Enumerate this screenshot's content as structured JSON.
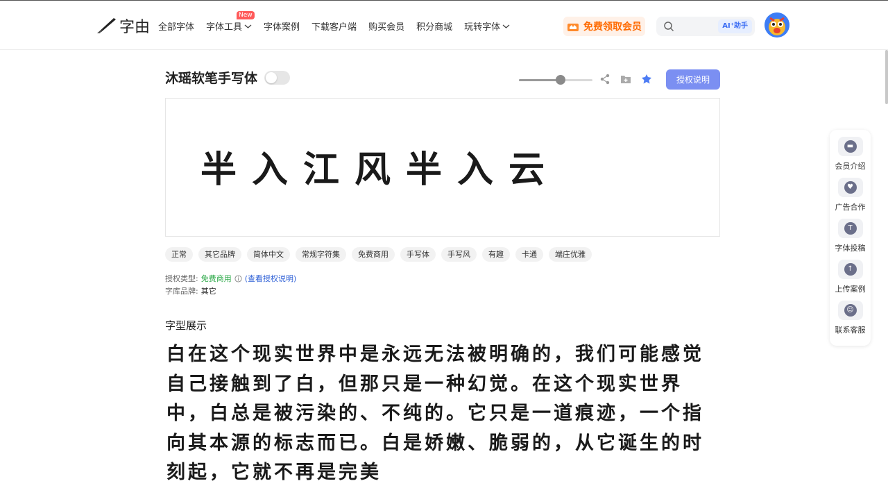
{
  "header": {
    "logo_text": "字由",
    "nav": [
      {
        "label": "全部字体",
        "dropdown": false,
        "badge": ""
      },
      {
        "label": "字体工具",
        "dropdown": true,
        "badge": "New"
      },
      {
        "label": "字体案例",
        "dropdown": false,
        "badge": ""
      },
      {
        "label": "下载客户端",
        "dropdown": false,
        "badge": ""
      },
      {
        "label": "购买会员",
        "dropdown": false,
        "badge": ""
      },
      {
        "label": "积分商城",
        "dropdown": false,
        "badge": ""
      },
      {
        "label": "玩转字体",
        "dropdown": true,
        "badge": ""
      }
    ],
    "vip_button": "免费领取会员",
    "search_placeholder": "",
    "ai_label": "AI⁺助手"
  },
  "font": {
    "title": "沐瑶软笔手写体",
    "license_button": "授权说明",
    "size_slider_level": 0.57,
    "preview_text": "半入江风半入云"
  },
  "tags": [
    "正常",
    "其它品牌",
    "简体中文",
    "常规字符集",
    "免费商用",
    "手写体",
    "手写风",
    "有趣",
    "卡通",
    "端庄优雅"
  ],
  "meta": {
    "license_label": "授权类型:",
    "license_value": "免费商用",
    "license_link": "(查看授权说明)",
    "brand_label": "字库品牌:",
    "brand_value": "其它"
  },
  "specimen": {
    "section_title": "字型展示",
    "text": "白在这个现实世界中是永远无法被明确的，我们可能感觉自己接触到了白，但那只是一种幻觉。在这个现实世界中，白总是被污染的、不纯的。它只是一道痕迹，一个指向其本源的标志而已。白是娇嫩、脆弱的，从它诞生的时刻起，它就不再是完美"
  },
  "side_panel": [
    {
      "label": "会员介绍",
      "icon": "vip-icon"
    },
    {
      "label": "广告合作",
      "icon": "handshake-icon"
    },
    {
      "label": "字体投稿",
      "icon": "submit-font-icon"
    },
    {
      "label": "上传案例",
      "icon": "upload-icon"
    },
    {
      "label": "联系客服",
      "icon": "customer-service-icon"
    }
  ],
  "colors": {
    "accent": "#7b8ff2",
    "vip_orange": "#ff6a00",
    "free_green": "#2faa4a",
    "link_blue": "#2d5fd6"
  }
}
